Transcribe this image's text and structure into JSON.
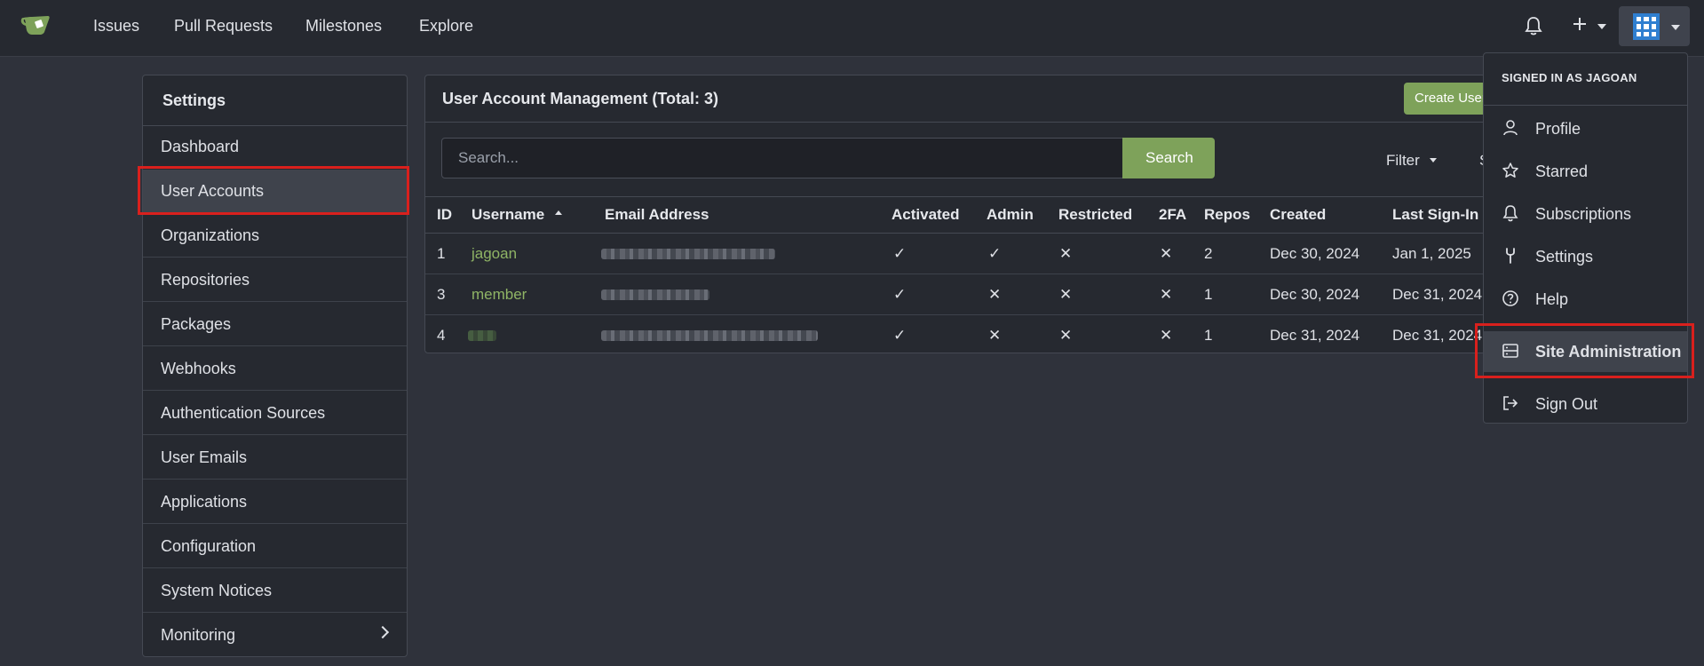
{
  "topbar": {
    "nav": [
      "Issues",
      "Pull Requests",
      "Milestones",
      "Explore"
    ],
    "icons": [
      "bell-icon",
      "plus-icon",
      "avatar"
    ]
  },
  "sidebar": {
    "title": "Settings",
    "items": [
      {
        "label": "Dashboard"
      },
      {
        "label": "User Accounts"
      },
      {
        "label": "Organizations"
      },
      {
        "label": "Repositories"
      },
      {
        "label": "Packages"
      },
      {
        "label": "Webhooks"
      },
      {
        "label": "Authentication Sources"
      },
      {
        "label": "User Emails"
      },
      {
        "label": "Applications"
      },
      {
        "label": "Configuration"
      },
      {
        "label": "System Notices"
      },
      {
        "label": "Monitoring"
      }
    ],
    "active_item": "User Accounts"
  },
  "main": {
    "title": "User Account Management (Total: 3)",
    "create_button": "Create User",
    "search": {
      "placeholder": "Search...",
      "button": "Search"
    },
    "filter_label": "Filter",
    "sort_partial": "S",
    "columns": [
      "ID",
      "Username",
      "Email Address",
      "Activated",
      "Admin",
      "Restricted",
      "2FA",
      "Repos",
      "Created",
      "Last Sign-In"
    ],
    "rows": [
      {
        "id": "1",
        "username": "jagoan",
        "activated": "✓",
        "admin": "✓",
        "restricted": "✕",
        "twofa": "✕",
        "repos": "2",
        "created": "Dec 30, 2024",
        "last_signin": "Jan 1, 2025"
      },
      {
        "id": "3",
        "username": "member",
        "activated": "✓",
        "admin": "✕",
        "restricted": "✕",
        "twofa": "✕",
        "repos": "1",
        "created": "Dec 30, 2024",
        "last_signin": "Dec 31, 2024"
      },
      {
        "id": "4",
        "username": "",
        "activated": "✓",
        "admin": "✕",
        "restricted": "✕",
        "twofa": "✕",
        "repos": "1",
        "created": "Dec 31, 2024",
        "last_signin": "Dec 31, 2024"
      }
    ]
  },
  "dropdown": {
    "header": "SIGNED IN AS JAGOAN",
    "items": [
      {
        "label": "Profile",
        "icon": "person-icon"
      },
      {
        "label": "Starred",
        "icon": "star-icon"
      },
      {
        "label": "Subscriptions",
        "icon": "bell-icon"
      },
      {
        "label": "Settings",
        "icon": "tools-icon"
      },
      {
        "label": "Help",
        "icon": "question-icon"
      },
      {
        "label": "Site Administration",
        "icon": "server-icon"
      },
      {
        "label": "Sign Out",
        "icon": "sign-out-icon"
      }
    ],
    "highlighted_item": "Site Administration"
  },
  "colors": {
    "accent": "#7ea25a",
    "highlight_box": "#d9201d",
    "background": "#2f323b"
  }
}
